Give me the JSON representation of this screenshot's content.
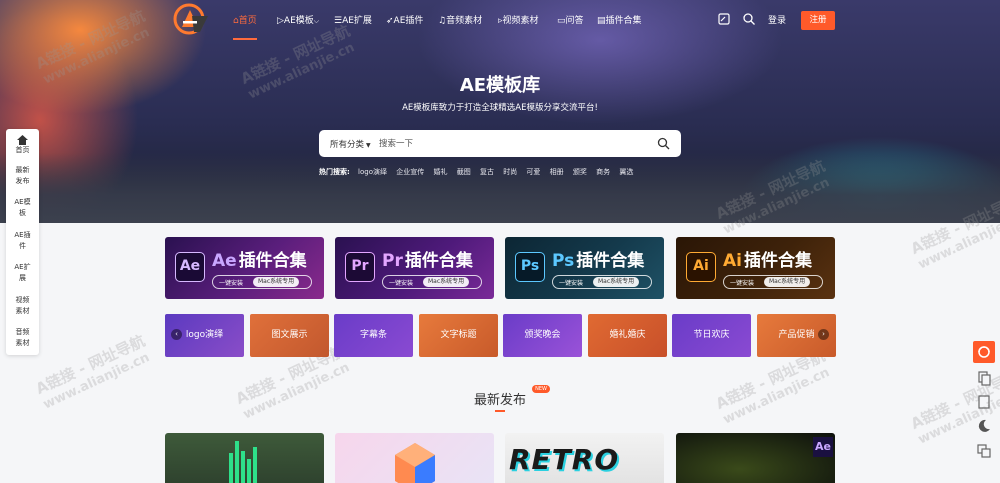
{
  "nav": {
    "items": [
      {
        "label": "首页",
        "active": true
      },
      {
        "label": "AE模板"
      },
      {
        "label": "AE扩展"
      },
      {
        "label": "AE插件"
      },
      {
        "label": "音频素材"
      },
      {
        "label": "视频素材"
      },
      {
        "label": "问答"
      },
      {
        "label": "插件合集"
      }
    ],
    "login": "登录",
    "register": "注册"
  },
  "hero": {
    "title": "AE模板库",
    "subtitle": "AE模板库致力于打造全球精选AE模版分享交流平台!"
  },
  "search": {
    "category": "所有分类",
    "placeholder": "搜索一下"
  },
  "hot": {
    "label": "热门搜索:",
    "keywords": [
      "logo演绎",
      "企业宣传",
      "婚礼",
      "截图",
      "复古",
      "时尚",
      "可爱",
      "相册",
      "颁奖",
      "商务",
      "翼选"
    ]
  },
  "sidebar": {
    "items": [
      {
        "label": "首页"
      },
      {
        "label": "最新发布"
      },
      {
        "label": "AE模板"
      },
      {
        "label": "AE插件"
      },
      {
        "label": "AE扩展"
      },
      {
        "label": "视频素材"
      },
      {
        "label": "音频素材"
      }
    ]
  },
  "banners": [
    {
      "badge": "Ae",
      "prefix": "Ae",
      "title": "插件合集",
      "install": "一键安装",
      "mac": "Mac系统专用",
      "color": "#c9a7ff"
    },
    {
      "badge": "Pr",
      "prefix": "Pr",
      "title": "插件合集",
      "install": "一键安装",
      "mac": "Mac系统专用",
      "color": "#e3a6ff"
    },
    {
      "badge": "Ps",
      "prefix": "Ps",
      "title": "插件合集",
      "install": "一键安装",
      "mac": "Mac系统专用",
      "color": "#5cc8ff"
    },
    {
      "badge": "Ai",
      "prefix": "Ai",
      "title": "插件合集",
      "install": "一键安装",
      "mac": "Mac系统专用",
      "color": "#ffaa33"
    }
  ],
  "tiles": [
    {
      "label": "logo演绎"
    },
    {
      "label": "图文展示"
    },
    {
      "label": "字幕条"
    },
    {
      "label": "文字标题"
    },
    {
      "label": "颁奖晚会"
    },
    {
      "label": "婚礼婚庆"
    },
    {
      "label": "节日欢庆"
    },
    {
      "label": "产品促销"
    }
  ],
  "section": {
    "title": "最新发布",
    "badge": "NEW"
  },
  "cards": [
    {
      "text": ""
    },
    {
      "text": ""
    },
    {
      "text": "RETRO"
    },
    {
      "text": "Ae"
    }
  ],
  "watermark": {
    "line1": "A链接 - 网址导航",
    "line2": "www.alianjie.cn"
  },
  "colors": {
    "accent": "#ff5a2a",
    "active_nav": "#ff6b3d"
  }
}
